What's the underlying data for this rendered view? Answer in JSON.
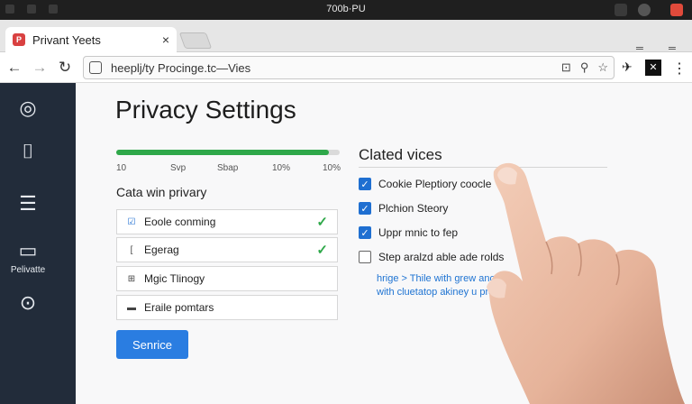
{
  "window": {
    "title": "700b·PU"
  },
  "tab": {
    "title": "Privant Yeets",
    "close_glyph": "×",
    "favicon_glyph": "P"
  },
  "toolbar": {
    "back_glyph": "←",
    "forward_glyph": "→",
    "reload_glyph": "↻",
    "url": "heeplj/ty Procinge.tc—Vies",
    "action_glyphs": [
      "⊡",
      "⚲",
      "☆"
    ],
    "ext_glyphs": [
      "✈",
      "✕"
    ]
  },
  "sidebar": {
    "items": [
      {
        "icon": "target-icon",
        "glyph": "◎",
        "label": ""
      },
      {
        "icon": "phone-icon",
        "glyph": "⌷",
        "label": ""
      },
      {
        "icon": "document-icon",
        "glyph": "☰",
        "label": ""
      },
      {
        "icon": "monitor-icon",
        "glyph": "▭",
        "label": "Pelivatte"
      },
      {
        "icon": "clock-icon",
        "glyph": "⊙",
        "label": ""
      }
    ]
  },
  "main": {
    "title": "Privacy Settings",
    "progress": {
      "value": 0.95,
      "color": "#2fa84a"
    },
    "scale_labels": [
      "10",
      "Svp",
      "Sbap",
      "10%",
      "10%"
    ],
    "section_label": "Cata win privary",
    "options": [
      {
        "label": "Eoole conming",
        "icon": "checkbox-icon",
        "glyph": "☑",
        "checked": true
      },
      {
        "label": "Egerag",
        "icon": "bracket-icon",
        "glyph": "[",
        "checked": true
      },
      {
        "label": "Mgic Tlinogy",
        "icon": "image-icon",
        "glyph": "⊞",
        "checked": false
      },
      {
        "label": "Eraile pomtars",
        "icon": "bar-icon",
        "glyph": "▬",
        "checked": false
      }
    ],
    "save_label": "Senrice"
  },
  "right_panel": {
    "title": "Clated vices",
    "checkboxes": [
      {
        "label": "Cookie Pleptiory coocle",
        "checked": true
      },
      {
        "label": "Plchion Steory",
        "checked": true
      },
      {
        "label": "Uppr mnic to fep",
        "checked": true
      },
      {
        "label": "Step aralzd able ade rolds",
        "checked": false
      }
    ],
    "help_lines": [
      "hrige > Thile with grew anc",
      "with cluetatop akiney u prcs"
    ]
  },
  "colors": {
    "accent": "#2a7de1",
    "sidebar_bg": "#222c3a",
    "success": "#2fa84a",
    "link": "#1e73d2"
  }
}
